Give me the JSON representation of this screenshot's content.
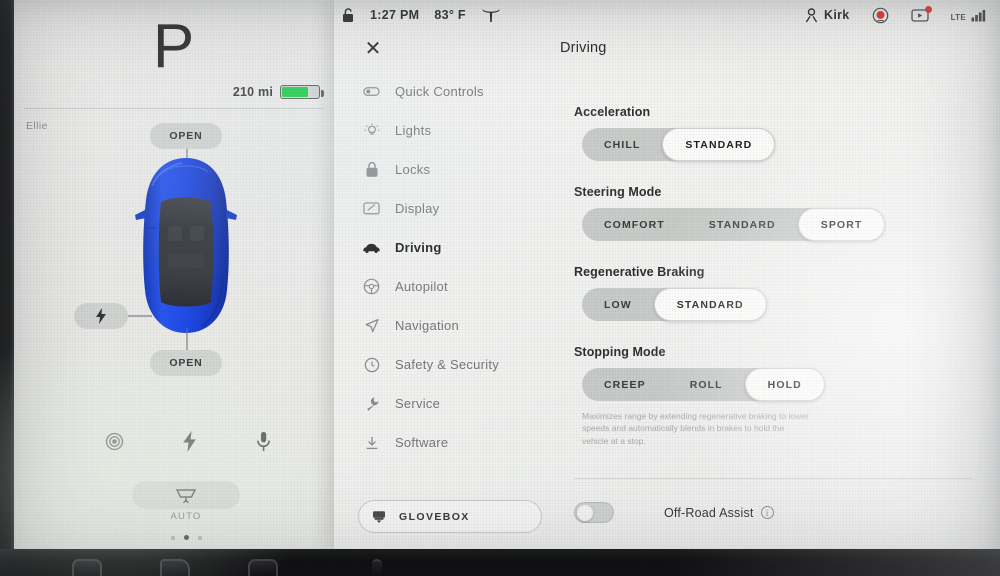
{
  "status_bar": {
    "lock_icon": "unlocked-padlock-icon",
    "time": "1:27 PM",
    "temperature": "83° F",
    "brand_logo": "tesla-t-logo",
    "driver_icon": "person-icon",
    "driver_name": "Kirk",
    "dashcam_icon": "dashcam-record-icon",
    "dashcam_color": "#e0342c",
    "media_icon": "media-notification-icon",
    "network_label": "LTE",
    "signal_icon": "signal-bars-icon"
  },
  "car_panel": {
    "gear": "P",
    "range": "210 mi",
    "battery_percent": 68,
    "battery_color": "#1fd04a",
    "profile_name": "Ellie",
    "car_color": "#1a46e8",
    "frunk_button": "OPEN",
    "trunk_button": "OPEN",
    "charge_port_icon": "lightning-bolt-icon",
    "quick_icons": [
      {
        "name": "camera-icon"
      },
      {
        "name": "lightning-bolt-icon"
      },
      {
        "name": "microphone-icon"
      }
    ],
    "wiper_icon": "windshield-wiper-icon",
    "wiper_mode": "AUTO",
    "page_dots": {
      "count": 3,
      "active_index": 1
    }
  },
  "modal": {
    "close_icon": "close-x-icon",
    "title": "Driving",
    "nav_items": [
      {
        "label": "Quick Controls",
        "icon": "quick-controls-icon",
        "active": false
      },
      {
        "label": "Lights",
        "icon": "lightbulb-icon",
        "active": false
      },
      {
        "label": "Locks",
        "icon": "lock-icon",
        "active": false
      },
      {
        "label": "Display",
        "icon": "display-icon",
        "active": false
      },
      {
        "label": "Driving",
        "icon": "car-icon",
        "active": true
      },
      {
        "label": "Autopilot",
        "icon": "steering-wheel-icon",
        "active": false
      },
      {
        "label": "Navigation",
        "icon": "navigation-arrow-icon",
        "active": false
      },
      {
        "label": "Safety & Security",
        "icon": "shield-clock-icon",
        "active": false
      },
      {
        "label": "Service",
        "icon": "wrench-icon",
        "active": false
      },
      {
        "label": "Software",
        "icon": "download-icon",
        "active": false
      }
    ],
    "glovebox": {
      "label": "GLOVEBOX",
      "icon": "glovebox-icon"
    }
  },
  "settings": {
    "acceleration": {
      "label": "Acceleration",
      "options": [
        "CHILL",
        "STANDARD"
      ],
      "selected": "STANDARD"
    },
    "steering_mode": {
      "label": "Steering Mode",
      "options": [
        "COMFORT",
        "STANDARD",
        "SPORT"
      ],
      "selected": "SPORT"
    },
    "regenerative_braking": {
      "label": "Regenerative Braking",
      "options": [
        "LOW",
        "STANDARD"
      ],
      "selected": "STANDARD"
    },
    "stopping_mode": {
      "label": "Stopping Mode",
      "options": [
        "CREEP",
        "ROLL",
        "HOLD"
      ],
      "selected": "HOLD",
      "description": "Maximizes range by extending regenerative braking to lower speeds and automatically blends in brakes to hold the vehicle at a stop."
    },
    "off_road_assist": {
      "label": "Off-Road Assist",
      "info_icon": "info-circle-icon",
      "enabled": false
    }
  }
}
